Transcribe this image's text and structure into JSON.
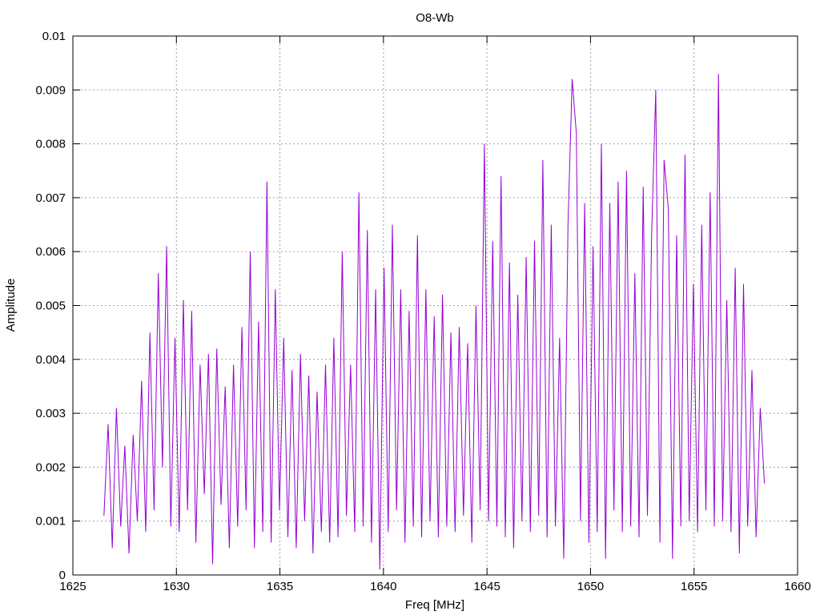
{
  "chart_data": {
    "type": "line",
    "title": "O8-Wb",
    "xlabel": "Freq [MHz]",
    "ylabel": "Amplitude",
    "xlim": [
      1625,
      1660
    ],
    "ylim": [
      0,
      0.01
    ],
    "grid": true,
    "x_ticks": [
      "1625",
      "1630",
      "1635",
      "1640",
      "1645",
      "1650",
      "1655",
      "1660"
    ],
    "x_tick_values": [
      1625,
      1630,
      1635,
      1640,
      1645,
      1650,
      1655,
      1660
    ],
    "y_ticks": [
      "0",
      "0.001",
      "0.002",
      "0.003",
      "0.004",
      "0.005",
      "0.006",
      "0.007",
      "0.008",
      "0.009",
      "0.01"
    ],
    "y_tick_values": [
      0,
      0.001,
      0.002,
      0.003,
      0.004,
      0.005,
      0.006,
      0.007,
      0.008,
      0.009,
      0.01
    ],
    "series": [
      {
        "name": "O8-Wb",
        "color": "#9400d3",
        "x_start": 1626.5,
        "x_end": 1658.4,
        "values": [
          0.0011,
          0.0028,
          0.0005,
          0.0031,
          0.0009,
          0.0024,
          0.0004,
          0.0026,
          0.001,
          0.0036,
          0.0008,
          0.0045,
          0.0012,
          0.0056,
          0.002,
          0.0061,
          0.0009,
          0.0044,
          0.0008,
          0.0051,
          0.0012,
          0.0049,
          0.0006,
          0.0039,
          0.0015,
          0.0041,
          0.0002,
          0.0042,
          0.0013,
          0.0035,
          0.0005,
          0.0039,
          0.0009,
          0.0046,
          0.0012,
          0.006,
          0.0005,
          0.0047,
          0.0008,
          0.0073,
          0.0006,
          0.0053,
          0.0012,
          0.0044,
          0.0007,
          0.0038,
          0.0005,
          0.0041,
          0.001,
          0.0037,
          0.0004,
          0.0034,
          0.0008,
          0.0039,
          0.0006,
          0.0044,
          0.0007,
          0.006,
          0.0011,
          0.0039,
          0.0008,
          0.0071,
          0.0009,
          0.0064,
          0.0006,
          0.0053,
          0.0001,
          0.0057,
          0.0008,
          0.0065,
          0.0012,
          0.0053,
          0.0006,
          0.0049,
          0.0009,
          0.0063,
          0.0007,
          0.0053,
          0.001,
          0.0048,
          0.0007,
          0.0052,
          0.0009,
          0.0045,
          0.0008,
          0.0046,
          0.0011,
          0.0043,
          0.0006,
          0.005,
          0.0012,
          0.008,
          0.001,
          0.0062,
          0.0009,
          0.0074,
          0.0007,
          0.0058,
          0.0005,
          0.0052,
          0.001,
          0.0059,
          0.0008,
          0.0062,
          0.0011,
          0.0077,
          0.0007,
          0.0065,
          0.0009,
          0.0044,
          0.0003,
          0.0065,
          0.0092,
          0.0082,
          0.001,
          0.0069,
          0.0006,
          0.0061,
          0.0008,
          0.008,
          0.0003,
          0.0069,
          0.0012,
          0.0073,
          0.0008,
          0.0075,
          0.0009,
          0.0056,
          0.0007,
          0.0072,
          0.0011,
          0.0063,
          0.009,
          0.0006,
          0.0077,
          0.0068,
          0.0003,
          0.0063,
          0.0009,
          0.0078,
          0.001,
          0.0054,
          0.0008,
          0.0065,
          0.0012,
          0.0071,
          0.0009,
          0.0093,
          0.001,
          0.0051,
          0.0008,
          0.0057,
          0.0004,
          0.0054,
          0.0009,
          0.0038,
          0.0007,
          0.0031,
          0.0017
        ]
      }
    ]
  }
}
